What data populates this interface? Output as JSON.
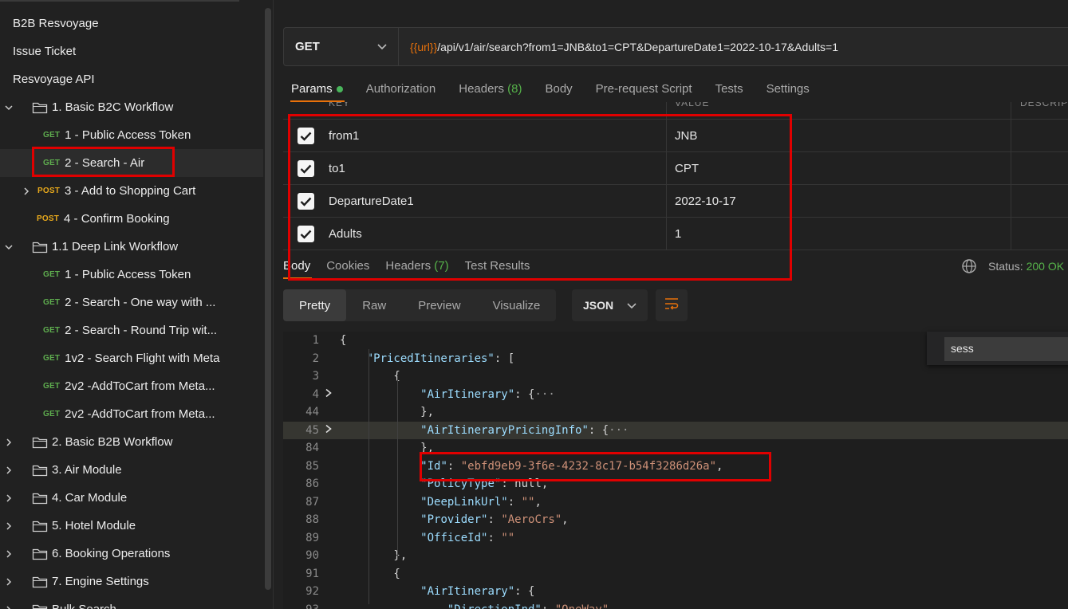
{
  "sidebar": {
    "items": [
      {
        "label": "B2B Resvoyage"
      },
      {
        "label": "Issue Ticket"
      },
      {
        "label": "Resvoyage API"
      },
      {
        "label": "1. Basic B2C Workflow"
      },
      {
        "method": "GET",
        "label": "1 - Public Access Token"
      },
      {
        "method": "GET",
        "label": "2 - Search - Air"
      },
      {
        "method": "POST",
        "label": "3 - Add to Shopping Cart"
      },
      {
        "method": "POST",
        "label": "4 - Confirm Booking"
      },
      {
        "label": "1.1 Deep Link Workflow"
      },
      {
        "method": "GET",
        "label": "1 - Public Access Token"
      },
      {
        "method": "GET",
        "label": "2 - Search - One way with ..."
      },
      {
        "method": "GET",
        "label": "2 - Search - Round Trip wit..."
      },
      {
        "method": "GET",
        "label": "1v2 - Search Flight with Meta"
      },
      {
        "method": "GET",
        "label": "2v2 -AddToCart from Meta..."
      },
      {
        "method": "GET",
        "label": "2v2 -AddToCart from Meta..."
      },
      {
        "label": "2. Basic B2B Workflow"
      },
      {
        "label": "3. Air Module"
      },
      {
        "label": "4. Car Module"
      },
      {
        "label": "5. Hotel Module"
      },
      {
        "label": "6. Booking Operations"
      },
      {
        "label": "7. Engine Settings"
      },
      {
        "label": "Bulk Search"
      }
    ]
  },
  "request": {
    "method": "GET",
    "url_var": "{{url}}",
    "url_rest": "/api/v1/air/search?from1=JNB&to1=CPT&DepartureDate1=2022-10-17&Adults=1"
  },
  "request_tabs": {
    "params": "Params",
    "authorization": "Authorization",
    "headers": "Headers",
    "headers_count": "(8)",
    "body": "Body",
    "prerequest": "Pre-request Script",
    "tests": "Tests",
    "settings": "Settings"
  },
  "params_header": {
    "key": "KEY",
    "value": "VALUE",
    "description": "DESCRIPTION"
  },
  "params": [
    {
      "key": "from1",
      "value": "JNB"
    },
    {
      "key": "to1",
      "value": "CPT"
    },
    {
      "key": "DepartureDate1",
      "value": "2022-10-17"
    },
    {
      "key": "Adults",
      "value": "1"
    }
  ],
  "response_tabs": {
    "body": "Body",
    "cookies": "Cookies",
    "headers": "Headers",
    "headers_count": "(7)",
    "test_results": "Test Results"
  },
  "status": {
    "label": "Status:",
    "value": "200 OK"
  },
  "view_modes": {
    "pretty": "Pretty",
    "raw": "Raw",
    "preview": "Preview",
    "visualize": "Visualize"
  },
  "format": "JSON",
  "find": {
    "value": "sess"
  },
  "code_lines": [
    {
      "num": "1",
      "text": "{"
    },
    {
      "num": "2",
      "text": "    \"PricedItineraries\": ["
    },
    {
      "num": "3",
      "text": "        {"
    },
    {
      "num": "4",
      "text": "            \"AirItinerary\": {···"
    },
    {
      "num": "44",
      "text": "            },"
    },
    {
      "num": "45",
      "text": "            \"AirItineraryPricingInfo\": {···"
    },
    {
      "num": "84",
      "text": "            },"
    },
    {
      "num": "85",
      "text": "            \"Id\": \"ebfd9eb9-3f6e-4232-8c17-b54f3286d26a\","
    },
    {
      "num": "86",
      "text": "            \"PolicyType\": null,"
    },
    {
      "num": "87",
      "text": "            \"DeepLinkUrl\": \"\","
    },
    {
      "num": "88",
      "text": "            \"Provider\": \"AeroCrs\","
    },
    {
      "num": "89",
      "text": "            \"OfficeId\": \"\""
    },
    {
      "num": "90",
      "text": "        },"
    },
    {
      "num": "91",
      "text": "        {"
    },
    {
      "num": "92",
      "text": "            \"AirItinerary\": {"
    },
    {
      "num": "93",
      "text": "                \"DirectionInd\": \"OneWay\","
    }
  ],
  "colors": {
    "accent_green": "#56b34a",
    "highlight_red": "#e00000",
    "post_orange": "#e8a91c",
    "url_var_orange": "#e8710a"
  }
}
